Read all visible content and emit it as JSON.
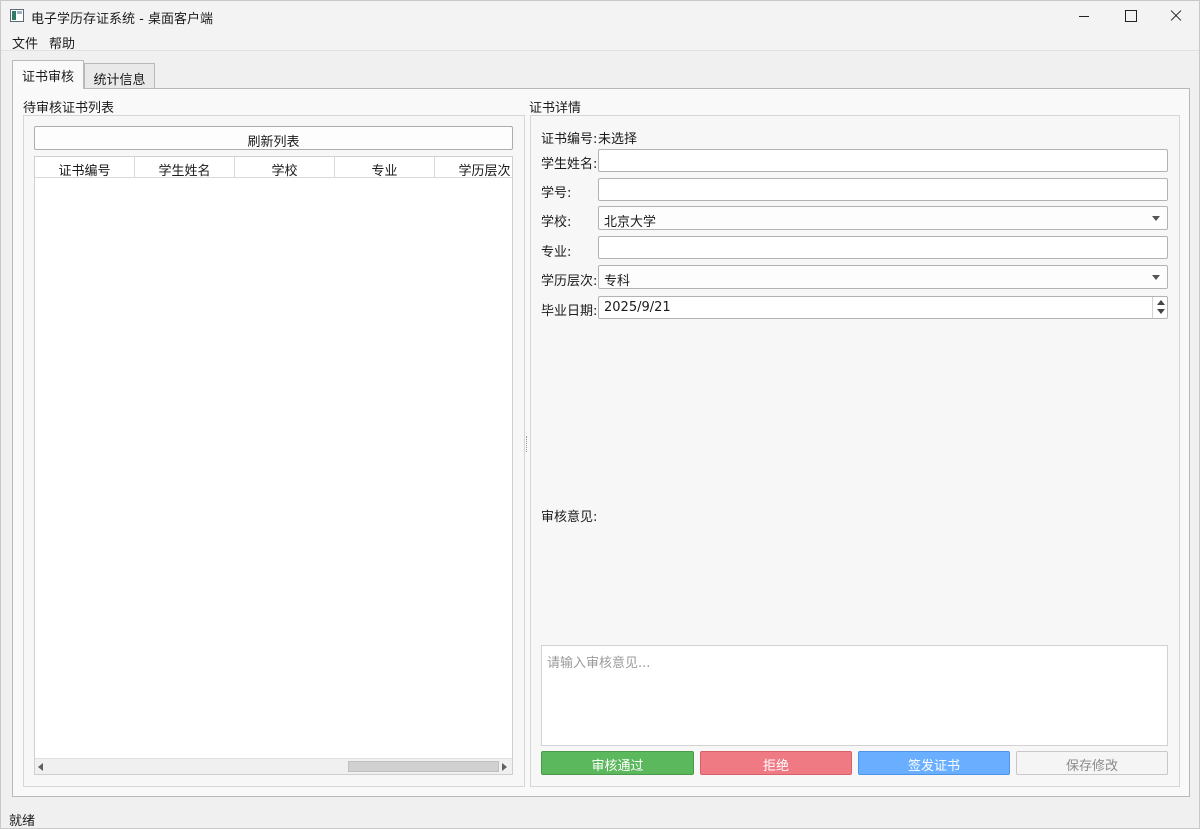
{
  "window": {
    "title": "电子学历存证系统 - 桌面客户端"
  },
  "menu": {
    "file": "文件",
    "help": "帮助"
  },
  "tabs": [
    {
      "label": "证书审核"
    },
    {
      "label": "统计信息"
    }
  ],
  "list_panel": {
    "title": "待审核证书列表",
    "refresh_label": "刷新列表",
    "columns": [
      "证书编号",
      "学生姓名",
      "学校",
      "专业",
      "学历层次"
    ]
  },
  "detail_panel": {
    "title": "证书详情",
    "cert_no_label": "证书编号:",
    "cert_no_value": "未选择",
    "student_name_label": "学生姓名:",
    "student_name_value": "",
    "student_id_label": "学号:",
    "student_id_value": "",
    "school_label": "学校:",
    "school_value": "北京大学",
    "major_label": "专业:",
    "major_value": "",
    "level_label": "学历层次:",
    "level_value": "专科",
    "grad_date_label": "毕业日期:",
    "grad_date_value": "2025/9/21",
    "opinion_label": "审核意见:",
    "opinion_placeholder": "请输入审核意见..."
  },
  "actions": {
    "approve": "审核通过",
    "reject": "拒绝",
    "issue": "签发证书",
    "save": "保存修改"
  },
  "colors": {
    "approve": "#5cb85c",
    "reject": "#f07a84",
    "issue": "#6aafff"
  },
  "status": {
    "text": "就绪"
  }
}
